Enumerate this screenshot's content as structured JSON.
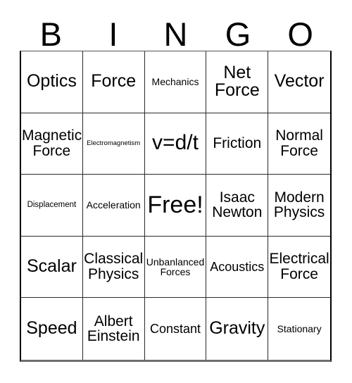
{
  "card": {
    "title_letters": [
      "B",
      "I",
      "N",
      "G",
      "O"
    ],
    "grid": {
      "rows": 5,
      "columns": 5,
      "cells": [
        {
          "text": "Optics",
          "size": "s-2xl"
        },
        {
          "text": "Force",
          "size": "s-2xl"
        },
        {
          "text": "Mechanics",
          "size": "s-md"
        },
        {
          "text": "Net\nForce",
          "size": "s-2xl"
        },
        {
          "text": "Vector",
          "size": "s-2xl"
        },
        {
          "text": "Magnetic\nForce",
          "size": "s-xl"
        },
        {
          "text": "Electromagnetism",
          "size": "s-xs"
        },
        {
          "text": "v=d/t",
          "size": "s-3xl"
        },
        {
          "text": "Friction",
          "size": "s-xl"
        },
        {
          "text": "Normal\nForce",
          "size": "s-xl"
        },
        {
          "text": "Displacement",
          "size": "s-sm"
        },
        {
          "text": "Acceleration",
          "size": "s-md"
        },
        {
          "text": "Free!",
          "size": "s-4xl"
        },
        {
          "text": "Isaac\nNewton",
          "size": "s-xl"
        },
        {
          "text": "Modern\nPhysics",
          "size": "s-xl"
        },
        {
          "text": "Scalar",
          "size": "s-2xl"
        },
        {
          "text": "Classical\nPhysics",
          "size": "s-xl"
        },
        {
          "text": "Unbanlanced\nForces",
          "size": "s-md"
        },
        {
          "text": "Acoustics",
          "size": "s-lg"
        },
        {
          "text": "Electrical\nForce",
          "size": "s-xl"
        },
        {
          "text": "Speed",
          "size": "s-2xl"
        },
        {
          "text": "Albert\nEinstein",
          "size": "s-xl"
        },
        {
          "text": "Constant",
          "size": "s-lg"
        },
        {
          "text": "Gravity",
          "size": "s-2xl"
        },
        {
          "text": "Stationary",
          "size": "s-md"
        }
      ]
    },
    "colors": {
      "background": "#ffffff",
      "text": "#000000",
      "grid_line": "#2a2a2a",
      "outer_border": "#000000",
      "bottom_border": "#6e6e6e"
    }
  }
}
